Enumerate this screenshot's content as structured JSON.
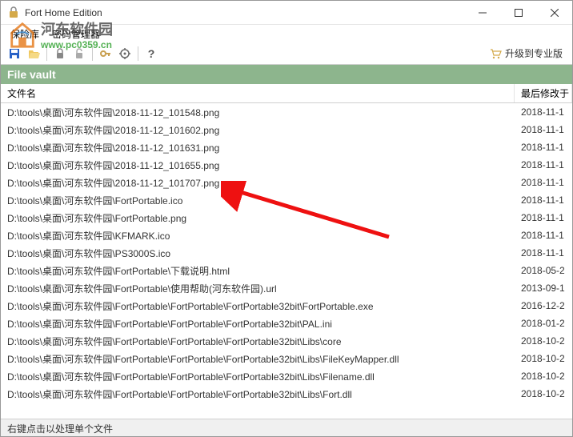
{
  "window": {
    "title": "Fort Home Edition"
  },
  "menu": {
    "vault": "保险库",
    "pwd_manager": "密码管理器"
  },
  "watermark": {
    "cn": "河东软件园",
    "url": "www.pc0359.cn"
  },
  "toolbar": {
    "upgrade_label": "升级到专业版"
  },
  "vault_header": "File vault",
  "columns": {
    "name": "文件名",
    "modified": "最后修改于"
  },
  "files": [
    {
      "name": "D:\\tools\\桌面\\河东软件园\\2018-11-12_101548.png",
      "date": "2018-11-1"
    },
    {
      "name": "D:\\tools\\桌面\\河东软件园\\2018-11-12_101602.png",
      "date": "2018-11-1"
    },
    {
      "name": "D:\\tools\\桌面\\河东软件园\\2018-11-12_101631.png",
      "date": "2018-11-1"
    },
    {
      "name": "D:\\tools\\桌面\\河东软件园\\2018-11-12_101655.png",
      "date": "2018-11-1"
    },
    {
      "name": "D:\\tools\\桌面\\河东软件园\\2018-11-12_101707.png",
      "date": "2018-11-1"
    },
    {
      "name": "D:\\tools\\桌面\\河东软件园\\FortPortable.ico",
      "date": "2018-11-1"
    },
    {
      "name": "D:\\tools\\桌面\\河东软件园\\FortPortable.png",
      "date": "2018-11-1"
    },
    {
      "name": "D:\\tools\\桌面\\河东软件园\\KFMARK.ico",
      "date": "2018-11-1"
    },
    {
      "name": "D:\\tools\\桌面\\河东软件园\\PS3000S.ico",
      "date": "2018-11-1"
    },
    {
      "name": "D:\\tools\\桌面\\河东软件园\\FortPortable\\下载说明.html",
      "date": "2018-05-2"
    },
    {
      "name": "D:\\tools\\桌面\\河东软件园\\FortPortable\\使用帮助(河东软件园).url",
      "date": "2013-09-1"
    },
    {
      "name": "D:\\tools\\桌面\\河东软件园\\FortPortable\\FortPortable\\FortPortable32bit\\FortPortable.exe",
      "date": "2016-12-2"
    },
    {
      "name": "D:\\tools\\桌面\\河东软件园\\FortPortable\\FortPortable\\FortPortable32bit\\PAL.ini",
      "date": "2018-01-2"
    },
    {
      "name": "D:\\tools\\桌面\\河东软件园\\FortPortable\\FortPortable\\FortPortable32bit\\Libs\\core",
      "date": "2018-10-2"
    },
    {
      "name": "D:\\tools\\桌面\\河东软件园\\FortPortable\\FortPortable\\FortPortable32bit\\Libs\\FileKeyMapper.dll",
      "date": "2018-10-2"
    },
    {
      "name": "D:\\tools\\桌面\\河东软件园\\FortPortable\\FortPortable\\FortPortable32bit\\Libs\\Filename.dll",
      "date": "2018-10-2"
    },
    {
      "name": "D:\\tools\\桌面\\河东软件园\\FortPortable\\FortPortable\\FortPortable32bit\\Libs\\Fort.dll",
      "date": "2018-10-2"
    }
  ],
  "statusbar": "右键点击以处理单个文件"
}
